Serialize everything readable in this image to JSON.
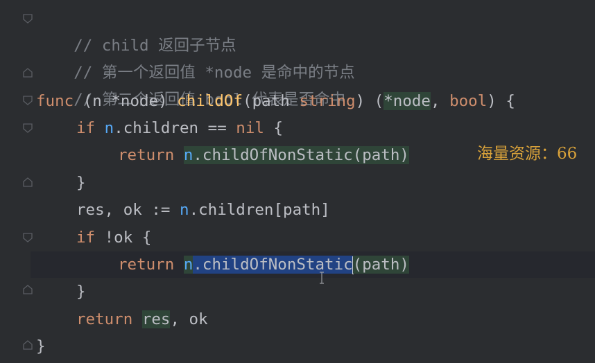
{
  "editor": {
    "lines": {
      "l1": {
        "comment": "// child 返回子节点"
      },
      "l2": {
        "comment": "// 第一个返回值 *node 是命中的节点"
      },
      "l3": {
        "comment": "// 第二个返回值 bool 代表是否命中"
      },
      "l4": {
        "kw": "func",
        "open": " (",
        "recv": "n",
        "star": " *",
        "type1": "node",
        "close": ") ",
        "name": "childOf",
        "p1": "(",
        "param": "path",
        "sp": " ",
        "ptype": "string",
        "p2": ") (",
        "rstar": "*",
        "rtype": "node",
        "comma": ", ",
        "rtype2": "bool",
        "p3": ") {"
      },
      "l5": {
        "kw": "if",
        "rest1": " ",
        "recv": "n",
        "rest2": ".children == ",
        "nil": "nil",
        "rest3": " {"
      },
      "l6": {
        "kw": "return",
        "sp": " ",
        "recv": "n",
        "call": ".childOfNonStatic(path)"
      },
      "l7": {
        "brace": "}"
      },
      "l8": {
        "code": "res, ok := ",
        "recv": "n",
        "rest": ".children[path]"
      },
      "l9": {
        "kw": "if",
        "rest": " !ok {"
      },
      "l10": {
        "kw": "return",
        "sp": " ",
        "recv": "n",
        "dot": ".",
        "sel": "childOfNonStatic",
        "rest": "(path)"
      },
      "l11": {
        "brace": "}"
      },
      "l12": {
        "kw": "return",
        "sp": " ",
        "res": "res",
        "rest": ", ok"
      },
      "l13": {
        "brace": "}"
      }
    },
    "colors": {
      "background": "#2b2d30",
      "keyword": "#cf8e6d",
      "function": "#56a8f5",
      "comment": "#7a7e85",
      "selection": "#214283",
      "usage_highlight": "#2f4538",
      "watermark": "#d9a23a"
    },
    "icons": [
      "fold-open-icon",
      "fold-close-icon",
      "text-cursor-icon"
    ]
  },
  "watermark": {
    "text": "海量资源：66"
  }
}
